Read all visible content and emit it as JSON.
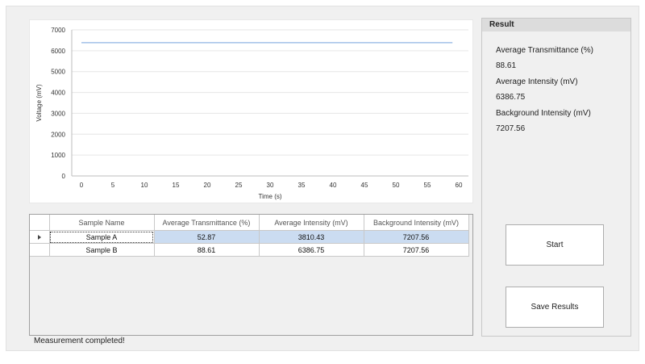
{
  "chart_data": {
    "type": "line",
    "xlabel": "Time (s)",
    "ylabel": "Voltage (mV)",
    "xlim": [
      0,
      60
    ],
    "ylim": [
      0,
      7000
    ],
    "x_ticks": [
      0,
      5,
      10,
      15,
      20,
      25,
      30,
      35,
      40,
      45,
      50,
      55,
      60
    ],
    "y_ticks": [
      0,
      1000,
      2000,
      3000,
      4000,
      5000,
      6000,
      7000
    ],
    "grid": true,
    "series": [
      {
        "x": [
          0,
          59
        ],
        "y": [
          6387,
          6387
        ],
        "color": "#8fb4e3"
      }
    ]
  },
  "table": {
    "columns": [
      "Sample Name",
      "Average Transmittance (%)",
      "Average Intensity (mV)",
      "Background Intensity (mV)"
    ],
    "rows": [
      [
        "Sample A",
        "52.87",
        "3810.43",
        "7207.56"
      ],
      [
        "Sample B",
        "88.61",
        "6386.75",
        "7207.56"
      ]
    ]
  },
  "result": {
    "title": "Result",
    "avg_transmittance_label": "Average Transmittance (%)",
    "avg_transmittance_value": "88.61",
    "avg_intensity_label": "Average Intensity (mV)",
    "avg_intensity_value": "6386.75",
    "bg_intensity_label": "Background Intensity (mV)",
    "bg_intensity_value": "7207.56"
  },
  "buttons": {
    "start": "Start",
    "save": "Save Results"
  },
  "status": "Measurement completed!"
}
